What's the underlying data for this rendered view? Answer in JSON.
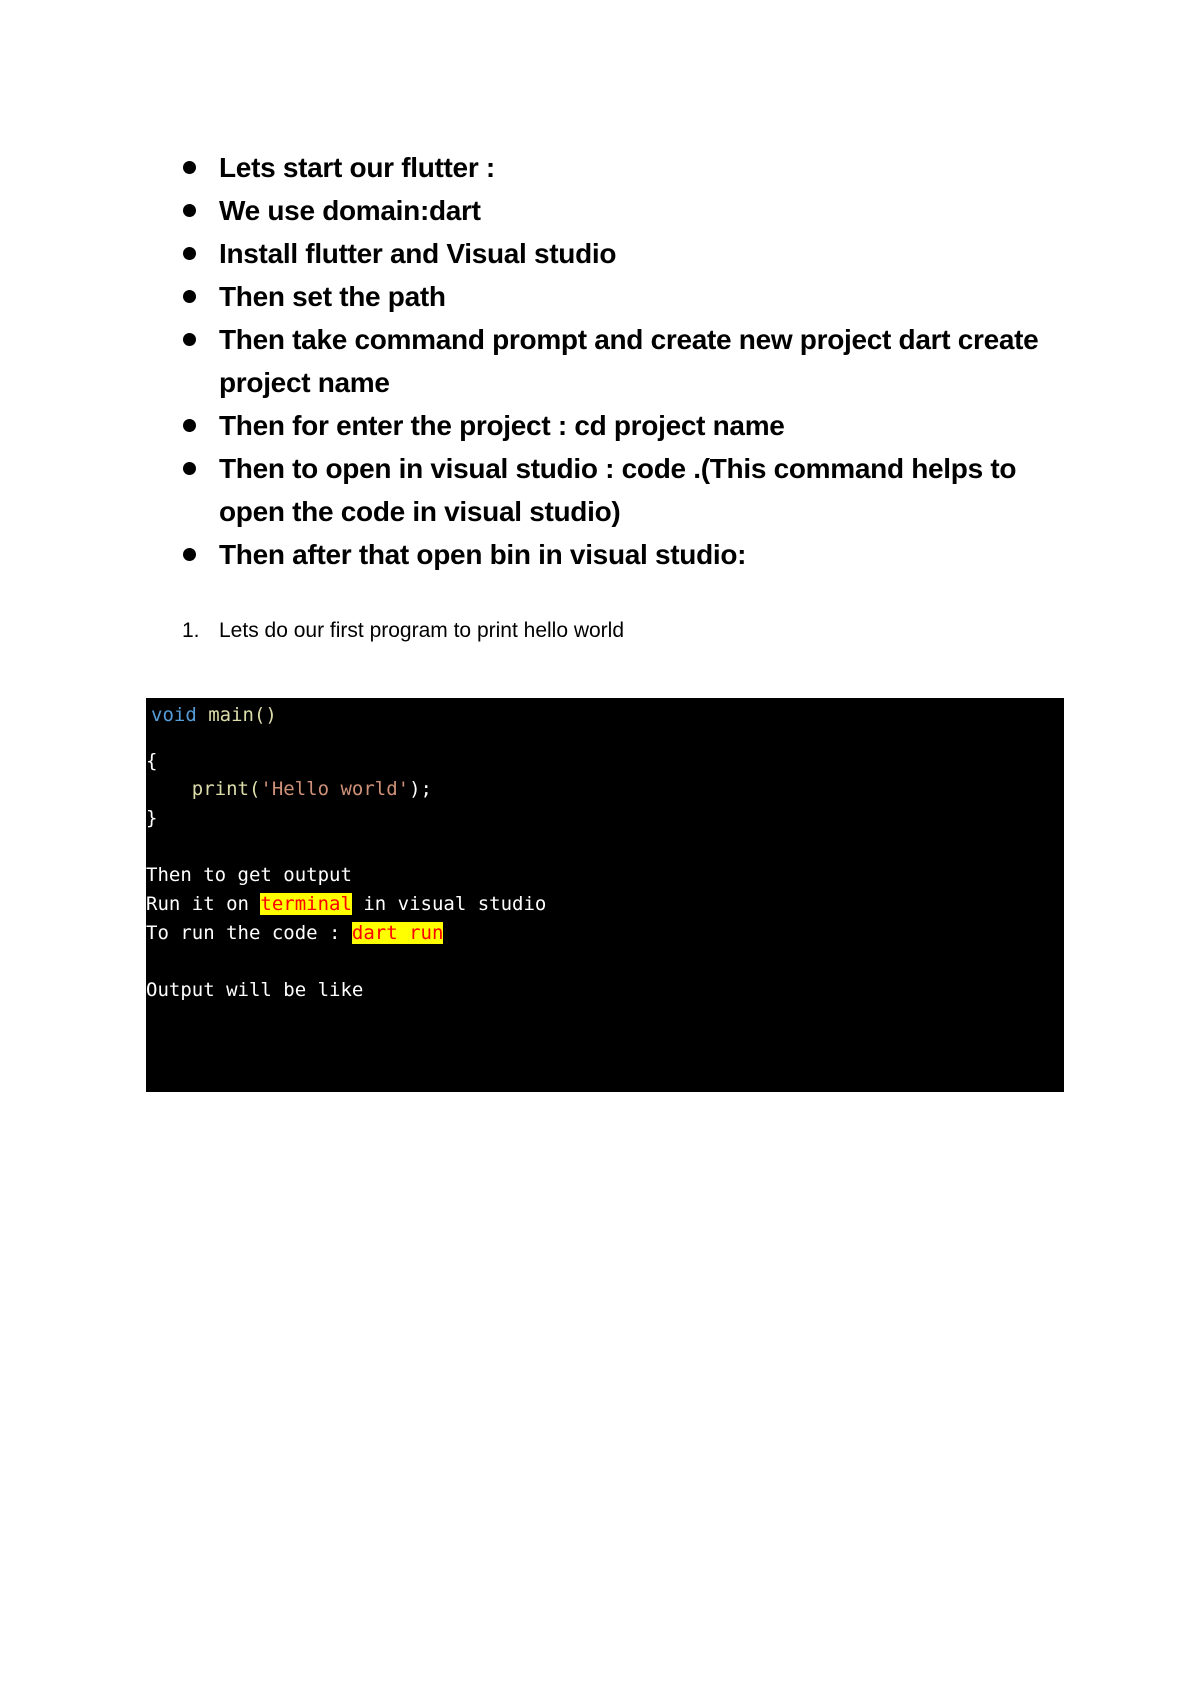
{
  "bullets": [
    "Lets start our flutter :",
    "We use domain:dart",
    "Install flutter and Visual studio",
    "Then set the path",
    "Then take command prompt and create new project dart create project name",
    "Then for enter the project : cd project name",
    "Then to open in visual studio : code .(This command helps to open the code in visual studio)",
    "Then after that open bin in visual studio:"
  ],
  "numbered": [
    {
      "number": "1.",
      "text": "Lets do our first program to print hello world"
    }
  ],
  "code": {
    "keyword": "void",
    "func_decl": " main()",
    "open_brace": "{",
    "print_fn": "    print(",
    "print_str": "'Hello world'",
    "print_end": ");",
    "close_brace": "}",
    "line_output": "Then to get output",
    "run_prefix": "Run it on ",
    "run_highlight": "terminal",
    "run_suffix": " in visual studio",
    "cmd_prefix": "To run the code : ",
    "cmd_highlight": "dart run",
    "output_line": "Output will be like"
  },
  "colors": {
    "keyword": "#569cd6",
    "function": "#dcdcaa",
    "string": "#ce9178",
    "highlight_bg": "#ffff00",
    "highlight_fg": "#ff0000"
  }
}
